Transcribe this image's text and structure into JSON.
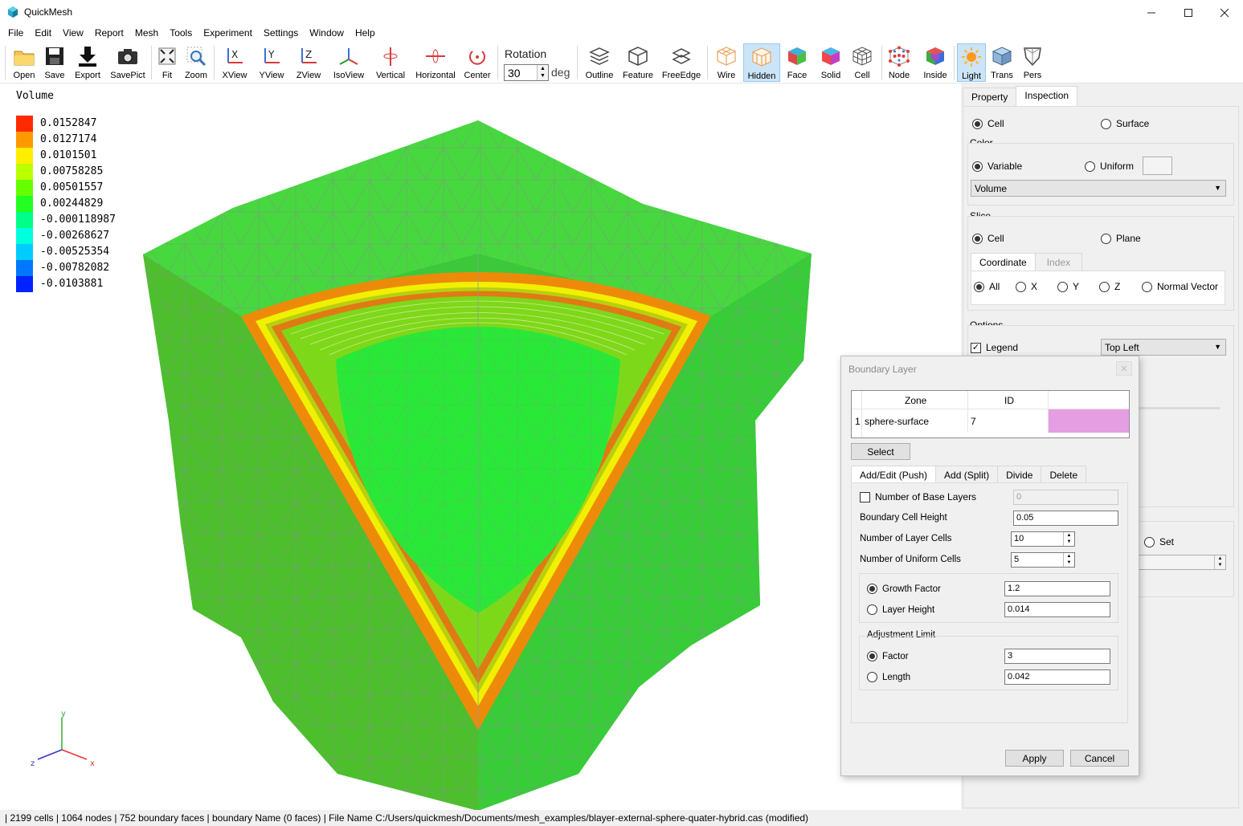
{
  "window": {
    "title": "QuickMesh"
  },
  "menu": [
    "File",
    "Edit",
    "View",
    "Report",
    "Mesh",
    "Tools",
    "Experiment",
    "Settings",
    "Window",
    "Help"
  ],
  "toolbar": {
    "open": "Open",
    "save": "Save",
    "export": "Export",
    "savepict": "SavePict",
    "fit": "Fit",
    "zoom": "Zoom",
    "xview": "XView",
    "yview": "YView",
    "zview": "ZView",
    "isoview": "IsoView",
    "vertical": "Vertical",
    "horizontal": "Horizontal",
    "center": "Center",
    "rotation_label": "Rotation",
    "rotation_value": "30",
    "rotation_unit": "deg",
    "outline": "Outline",
    "feature": "Feature",
    "freeedge": "FreeEdge",
    "wire": "Wire",
    "hidden": "Hidden",
    "face": "Face",
    "solid": "Solid",
    "cell": "Cell",
    "node": "Node",
    "inside": "Inside",
    "light": "Light",
    "trans": "Trans",
    "pers": "Pers"
  },
  "legend": {
    "title": "Volume",
    "items": [
      {
        "value": "0.0152847",
        "color": "#ff2a00"
      },
      {
        "value": "0.0127174",
        "color": "#ff9900"
      },
      {
        "value": "0.0101501",
        "color": "#ffee00"
      },
      {
        "value": "0.00758285",
        "color": "#bbff00"
      },
      {
        "value": "0.00501557",
        "color": "#66ff00"
      },
      {
        "value": "0.00244829",
        "color": "#22ff22"
      },
      {
        "value": "-0.000118987",
        "color": "#00ff88"
      },
      {
        "value": "-0.00268627",
        "color": "#00ffdd"
      },
      {
        "value": "-0.00525354",
        "color": "#00ccff"
      },
      {
        "value": "-0.00782082",
        "color": "#0077ff"
      },
      {
        "value": "-0.0103881",
        "color": "#0022ff"
      }
    ]
  },
  "axes": {
    "x": "x",
    "y": "y",
    "z": "z"
  },
  "panel": {
    "tabs": [
      "Property",
      "Inspection"
    ],
    "mode": {
      "cell": "Cell",
      "surface": "Surface"
    },
    "color_group": "Color",
    "color": {
      "variable": "Variable",
      "uniform": "Uniform",
      "selected": "Volume"
    },
    "slice_group": "Slice",
    "slice": {
      "cell": "Cell",
      "plane": "Plane"
    },
    "slice_tabs": [
      "Coordinate",
      "Index"
    ],
    "coord": {
      "all": "All",
      "x": "X",
      "y": "Y",
      "z": "Z",
      "normal": "Normal Vector"
    },
    "options_group": "Options",
    "legend_label": "Legend",
    "legend_pos": "Top Left",
    "set_label": "Set"
  },
  "dialog": {
    "title": "Boundary Layer",
    "table": {
      "headers": [
        "Zone",
        "ID"
      ],
      "rows": [
        {
          "index": "1",
          "zone": "sphere-surface",
          "id": "7",
          "color": "#e59ee2"
        }
      ]
    },
    "select": "Select",
    "tabs": [
      "Add/Edit (Push)",
      "Add (Split)",
      "Divide",
      "Delete"
    ],
    "base_layers_label": "Number of Base Layers",
    "base_layers": "0",
    "cell_height_label": "Boundary Cell Height",
    "cell_height": "0.05",
    "layer_cells_label": "Number of Layer Cells",
    "layer_cells": "10",
    "uniform_cells_label": "Number of Uniform Cells",
    "uniform_cells": "5",
    "growth_label": "Growth Factor",
    "growth": "1.2",
    "layer_height_label": "Layer Height",
    "layer_height": "0.014",
    "adj_group": "Adjustment Limit",
    "factor_label": "Factor",
    "factor": "3",
    "length_label": "Length",
    "length": "0.042",
    "apply": "Apply",
    "cancel": "Cancel"
  },
  "status": "| 2199 cells | 1064 nodes | 752 boundary faces |  boundary Name  (0 faces) | File Name C:/Users/quickmesh/Documents/mesh_examples/blayer-external-sphere-quater-hybrid.cas (modified)"
}
